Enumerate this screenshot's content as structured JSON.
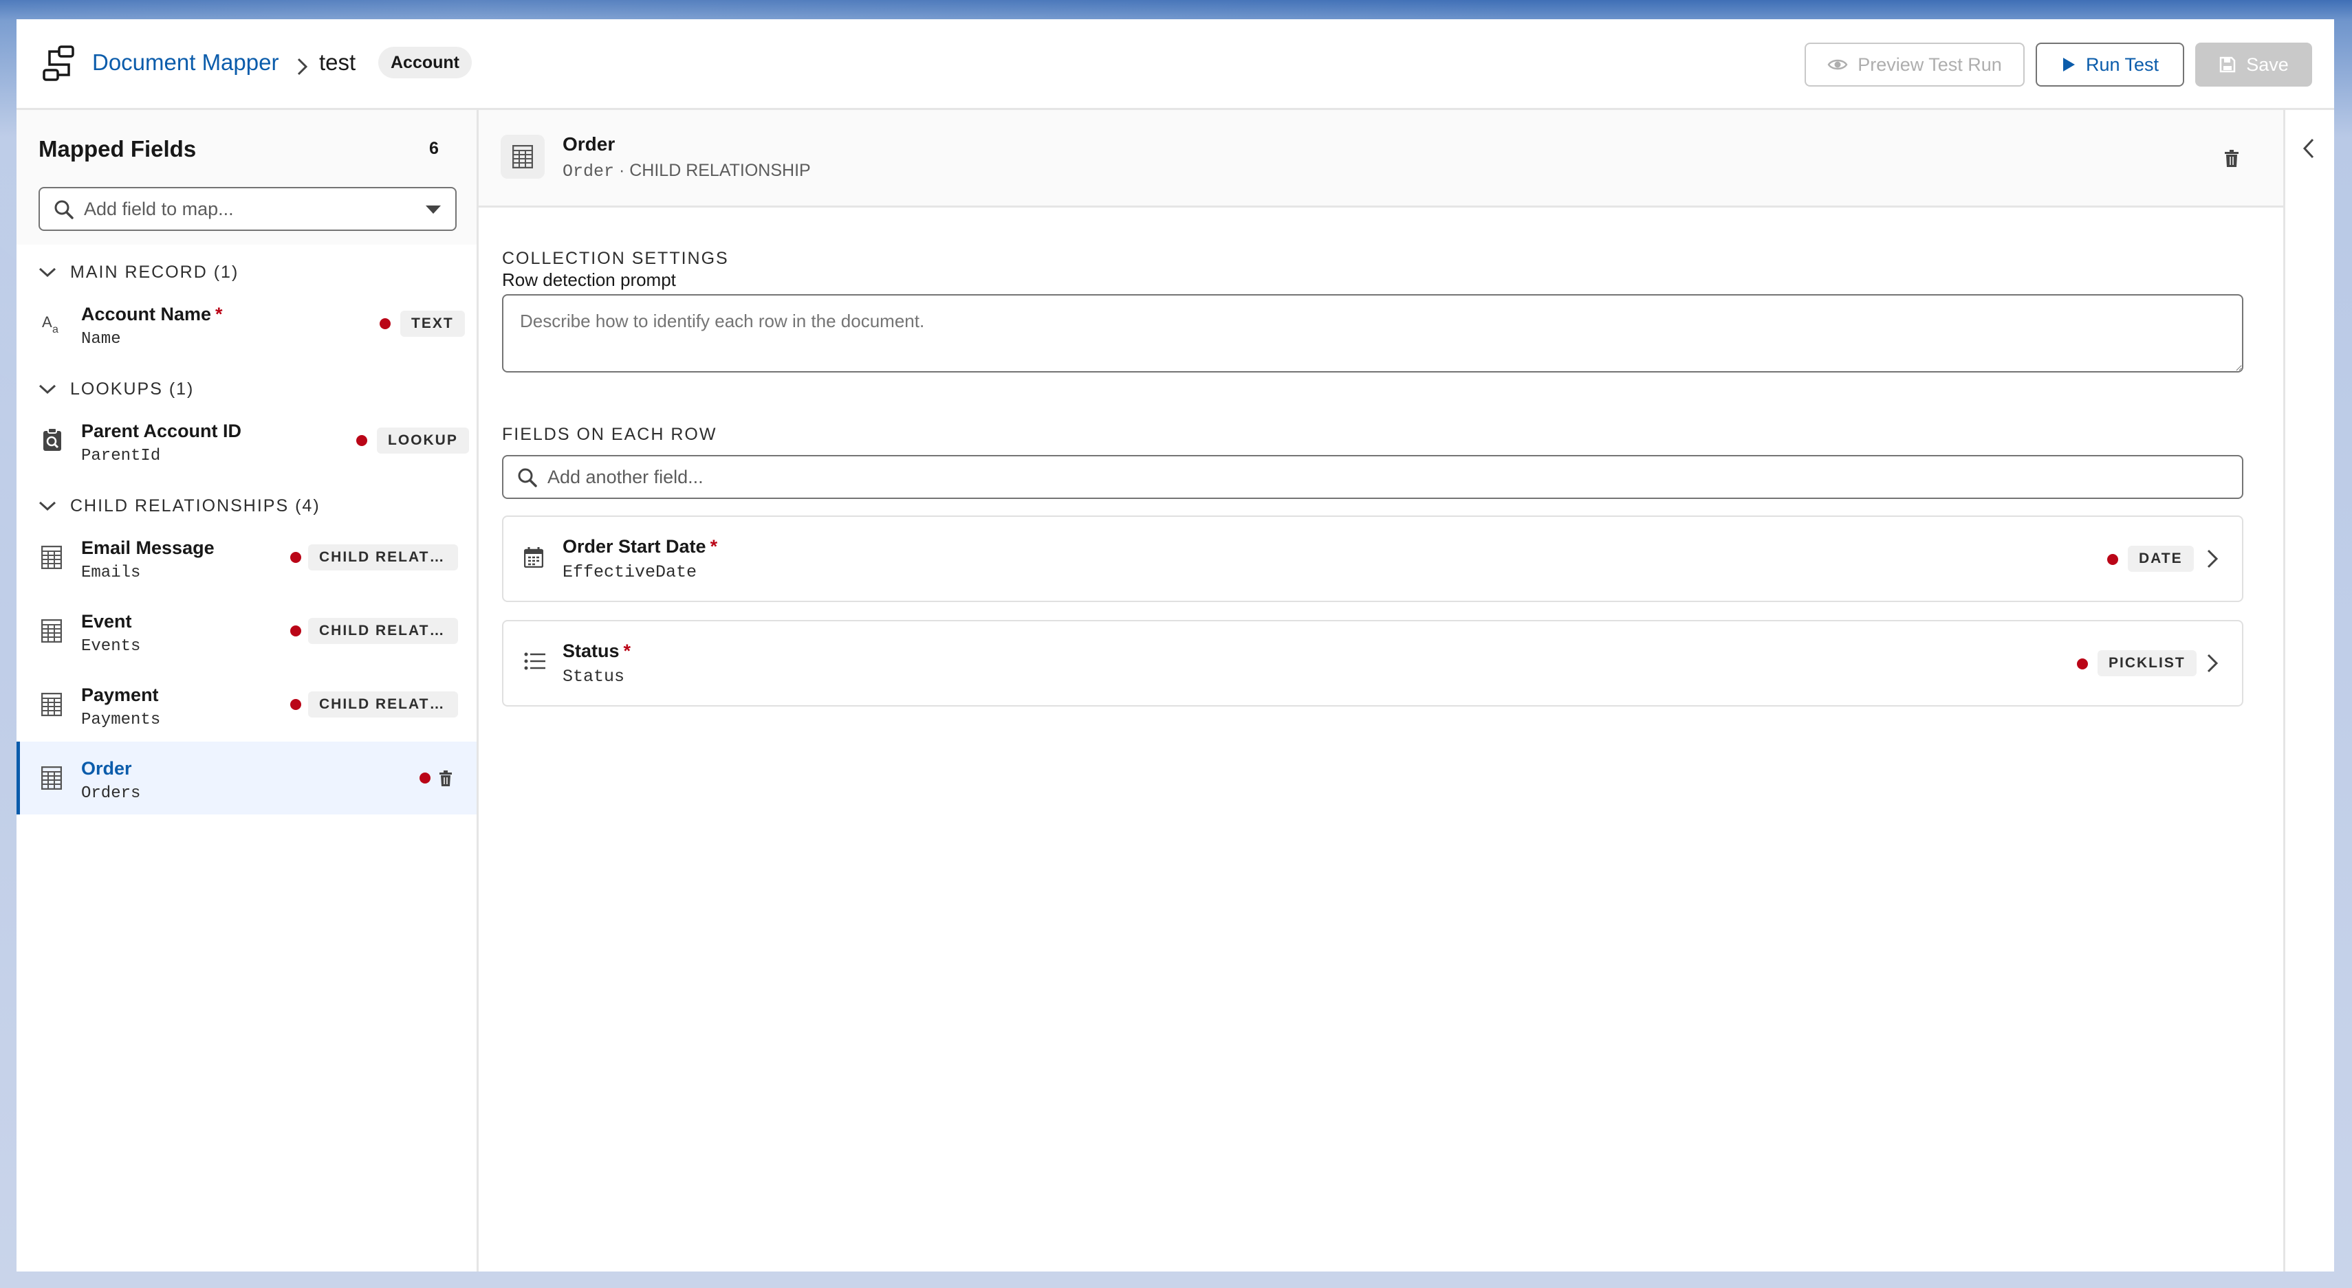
{
  "header": {
    "app_title": "Document Mapper",
    "record_name": "test",
    "object_badge": "Account",
    "buttons": {
      "preview": "Preview Test Run",
      "run": "Run Test",
      "save": "Save"
    }
  },
  "sidebar": {
    "title": "Mapped Fields",
    "count": "6",
    "search_placeholder": "Add field to map...",
    "sections": {
      "main": {
        "label": "MAIN RECORD (1)",
        "items": [
          {
            "name": "Account Name",
            "required": "*",
            "api": "Name",
            "type": "TEXT",
            "icon": "text-type-icon"
          }
        ]
      },
      "lookups": {
        "label": "LOOKUPS (1)",
        "items": [
          {
            "name": "Parent Account ID",
            "api": "ParentId",
            "type": "LOOKUP",
            "icon": "lookup-icon"
          }
        ]
      },
      "children": {
        "label": "CHILD RELATIONSHIPS (4)",
        "items": [
          {
            "name": "Email Message",
            "api": "Emails",
            "type": "CHILD RELATIONSHIP",
            "icon": "table-icon"
          },
          {
            "name": "Event",
            "api": "Events",
            "type": "CHILD RELATIONSHIP",
            "icon": "table-icon"
          },
          {
            "name": "Payment",
            "api": "Payments",
            "type": "CHILD RELATIONSHIP",
            "icon": "table-icon"
          },
          {
            "name": "Order",
            "api": "Orders",
            "type": "",
            "icon": "table-icon",
            "selected": true
          }
        ]
      }
    }
  },
  "detail": {
    "title": "Order",
    "subtitle_api": "Order",
    "subtitle_type": " · CHILD RELATIONSHIP",
    "collection_settings_label": "COLLECTION SETTINGS",
    "row_prompt_label": "Row detection prompt",
    "row_prompt_placeholder": "Describe how to identify each row in the document.",
    "fields_label": "FIELDS ON EACH ROW",
    "fields_search_placeholder": "Add another field...",
    "row_fields": [
      {
        "name": "Order Start Date",
        "required": "*",
        "api": "EffectiveDate",
        "type": "DATE",
        "icon": "calendar-icon"
      },
      {
        "name": "Status",
        "required": "*",
        "api": "Status",
        "type": "PICKLIST",
        "icon": "list-icon"
      }
    ]
  },
  "colors": {
    "brand": "#0b5cab",
    "required_dot": "#ba0517",
    "selected_bg": "#eef4ff"
  }
}
